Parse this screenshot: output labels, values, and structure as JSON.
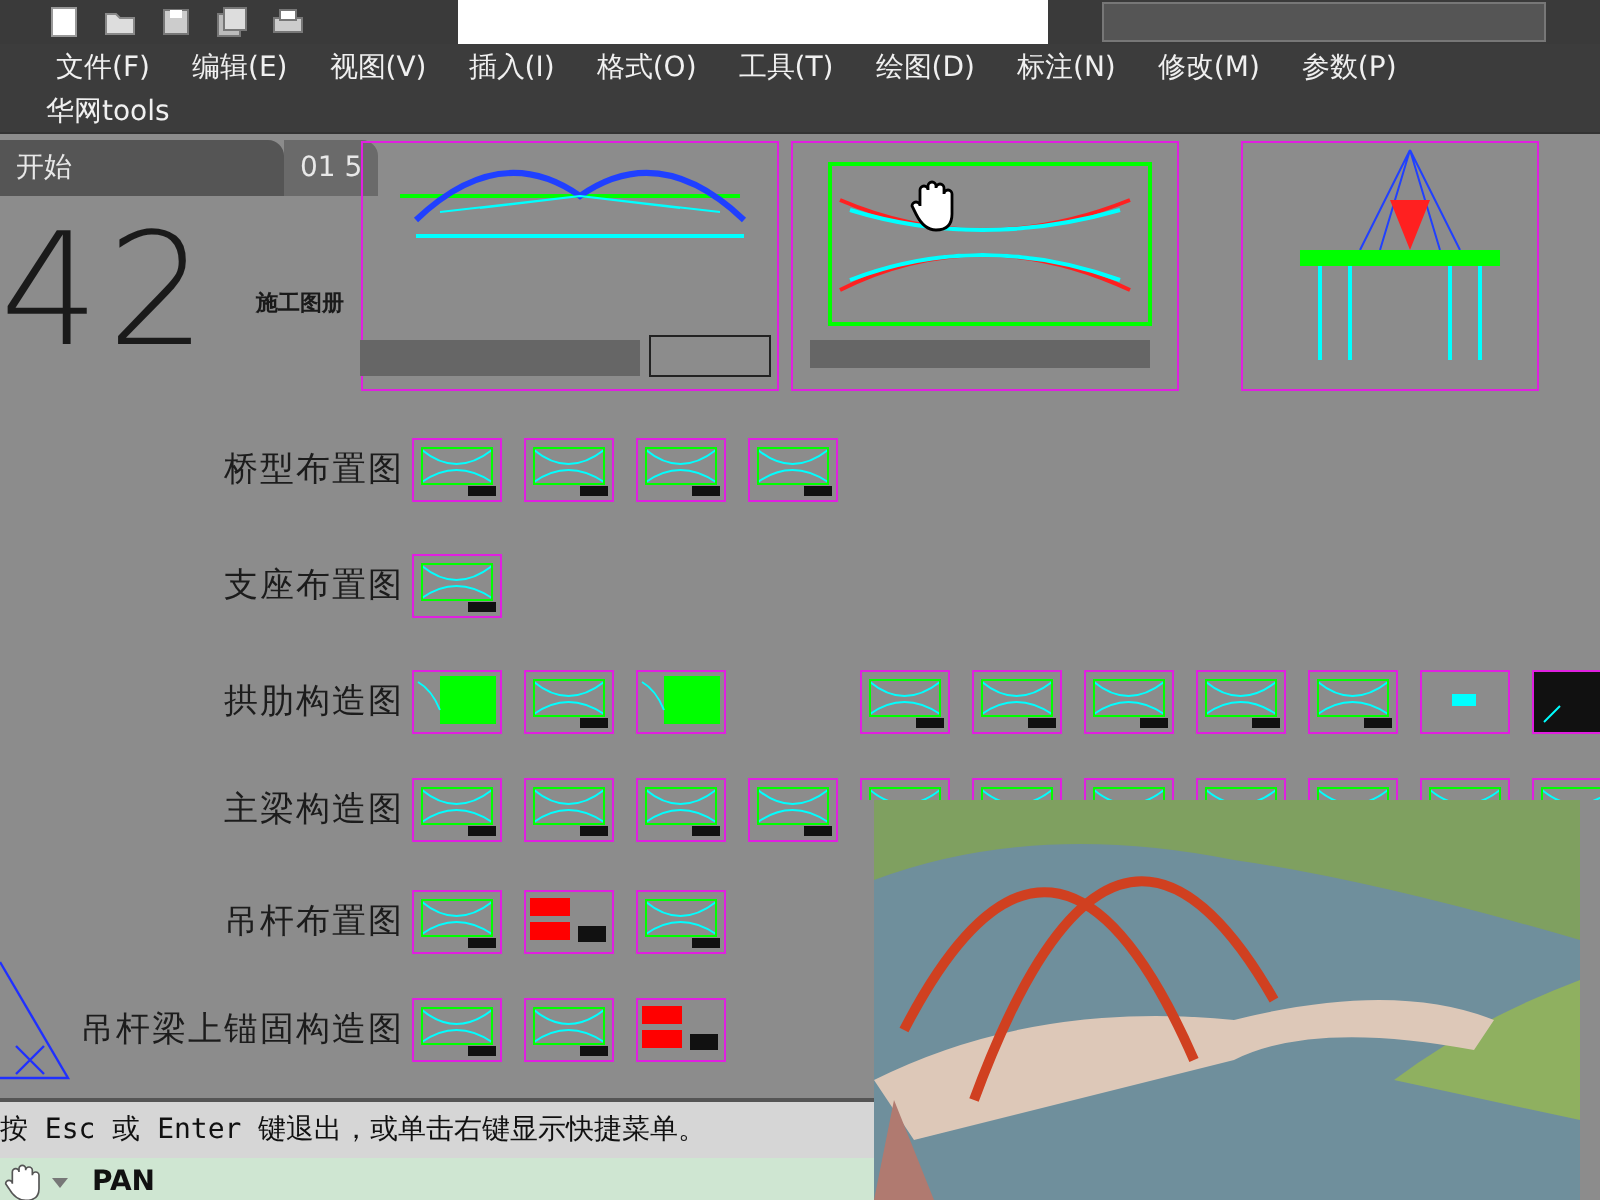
{
  "menu_bar": {
    "items": [
      "文件(F)",
      "编辑(E)",
      "视图(V)",
      "插入(I)",
      "格式(O)",
      "工具(T)",
      "绘图(D)",
      "标注(N)",
      "修改(M)",
      "参数(P)"
    ]
  },
  "tools_bar": {
    "label": "华网tools"
  },
  "tabs": [
    {
      "label": "开始",
      "selected": false
    },
    {
      "label": "01 5",
      "selected": true
    }
  ],
  "canvas": {
    "sheet_number": "42",
    "album_title": "施工图册",
    "rows": [
      {
        "label": "桥型布置图",
        "sheets": [
          {
            "kind": "lines"
          },
          {
            "kind": "lines"
          },
          {
            "kind": "lines"
          },
          {
            "kind": "lines"
          }
        ],
        "extra_sheets": []
      },
      {
        "label": "支座布置图",
        "sheets": [
          {
            "kind": "lines"
          }
        ],
        "extra_sheets": []
      },
      {
        "label": "拱肋构造图",
        "sheets": [
          {
            "kind": "green"
          },
          {
            "kind": "lines"
          },
          {
            "kind": "green"
          }
        ],
        "extra_sheets": [
          {
            "kind": "lines"
          },
          {
            "kind": "lines"
          },
          {
            "kind": "lines"
          },
          {
            "kind": "lines"
          },
          {
            "kind": "lines"
          },
          {
            "kind": "blank"
          },
          {
            "kind": "dark"
          }
        ]
      },
      {
        "label": "主梁构造图",
        "sheets": [
          {
            "kind": "lines"
          },
          {
            "kind": "lines"
          },
          {
            "kind": "lines"
          },
          {
            "kind": "lines"
          }
        ],
        "extra_sheets": [
          {
            "kind": "lines"
          },
          {
            "kind": "lines"
          },
          {
            "kind": "lines"
          },
          {
            "kind": "lines"
          },
          {
            "kind": "lines"
          },
          {
            "kind": "lines"
          },
          {
            "kind": "lines"
          }
        ]
      },
      {
        "label": "吊杆布置图",
        "sheets": [
          {
            "kind": "lines"
          },
          {
            "kind": "red"
          },
          {
            "kind": "lines"
          }
        ],
        "extra_sheets": []
      },
      {
        "label": "吊杆梁上锚固构造图",
        "sheets": [
          {
            "kind": "lines"
          },
          {
            "kind": "lines"
          },
          {
            "kind": "red"
          }
        ],
        "extra_sheets": []
      }
    ]
  },
  "command_line": {
    "prompt": "按 Esc 或 Enter 键退出，或单击右键显示快捷菜单。"
  },
  "command_status": {
    "command": "PAN"
  }
}
